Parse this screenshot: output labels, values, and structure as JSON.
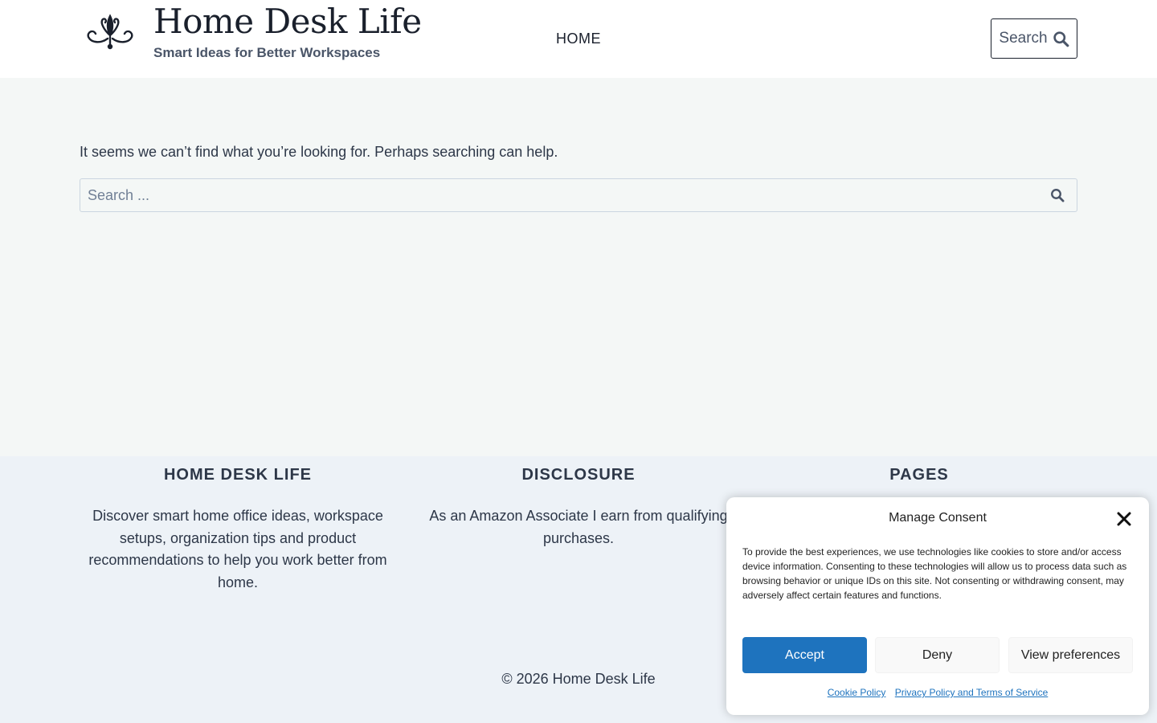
{
  "header": {
    "site_title": "Home Desk Life",
    "tagline": "Smart Ideas for Better Workspaces",
    "nav": [
      {
        "label": "HOME"
      }
    ],
    "search_button_label": "Search",
    "icons": {
      "logo": "flourish-ornament-icon",
      "search": "search-icon"
    }
  },
  "main": {
    "not_found_message": "It seems we can’t find what you’re looking for. Perhaps searching can help.",
    "search": {
      "placeholder": "Search ...",
      "value": ""
    }
  },
  "footer": {
    "columns": [
      {
        "heading": "HOME DESK LIFE",
        "text": "Discover smart home office ideas, workspace setups, organization tips and product recommendations to help you work better from home."
      },
      {
        "heading": "DISCLOSURE",
        "text_line1": "As an Amazon Associate I earn from qualifying",
        "text_line2": "purchases."
      },
      {
        "heading": "PAGES"
      }
    ],
    "copyright": "© 2026 Home Desk Life"
  },
  "consent": {
    "title": "Manage Consent",
    "body": "To provide the best experiences, we use technologies like cookies to store and/or access device information. Consenting to these technologies will allow us to process data such as browsing behavior or unique IDs on this site. Not consenting or withdrawing consent, may adversely affect certain features and functions.",
    "buttons": {
      "accept": "Accept",
      "deny": "Deny",
      "preferences": "View preferences"
    },
    "links": {
      "cookie_policy": "Cookie Policy",
      "privacy_policy": "Privacy Policy and Terms of Service"
    }
  },
  "colors": {
    "accent": "#1e73be",
    "header_bg": "#ffffff",
    "page_bg": "#f4f7f6",
    "footer_bg": "#edf2f7"
  }
}
